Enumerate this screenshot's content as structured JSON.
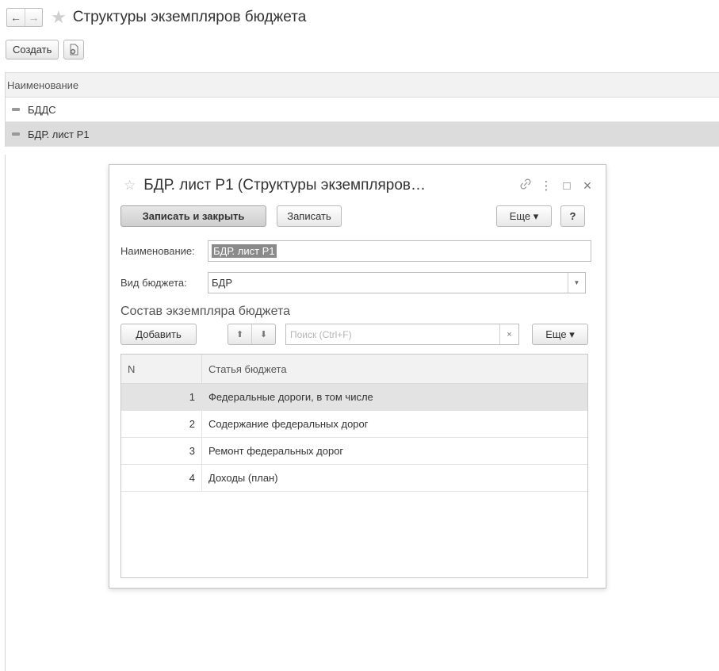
{
  "header": {
    "back_icon": "arrow-left-icon",
    "forward_icon": "arrow-right-icon",
    "favorite_icon": "star-icon",
    "title": "Структуры экземпляров бюджета"
  },
  "toolbar": {
    "create_label": "Создать",
    "copy_icon": "copy-document-icon"
  },
  "list": {
    "column_header": "Наименование",
    "rows": [
      {
        "label": "БДДС",
        "selected": false
      },
      {
        "label": "БДР. лист Р1",
        "selected": true
      }
    ]
  },
  "dialog": {
    "title": "БДР. лист Р1 (Структуры экземпляров…",
    "controls": {
      "link": "🔗",
      "menu": "⋮",
      "maximize": "□",
      "close": "×"
    },
    "toolbar": {
      "save_close_label": "Записать и закрыть",
      "save_label": "Записать",
      "more_label": "Еще ▾",
      "help_label": "?"
    },
    "name_label": "Наименование:",
    "name_value": "БДР. лист Р1",
    "budget_type_label": "Вид бюджета:",
    "budget_type_value": "БДР",
    "section_title": "Состав экземпляра бюджета",
    "table_toolbar": {
      "add_label": "Добавить",
      "search_placeholder": "Поиск (Ctrl+F)",
      "clear_label": "×",
      "more_label": "Еще ▾"
    },
    "table": {
      "columns": [
        "N",
        "Статья бюджета"
      ],
      "rows": [
        {
          "n": "1",
          "article": "Федеральные дороги, в том числе",
          "selected": true
        },
        {
          "n": "2",
          "article": "Содержание федеральных дорог",
          "selected": false
        },
        {
          "n": "3",
          "article": "Ремонт федеральных дорог",
          "selected": false
        },
        {
          "n": "4",
          "article": "Доходы (план)",
          "selected": false
        }
      ]
    }
  }
}
